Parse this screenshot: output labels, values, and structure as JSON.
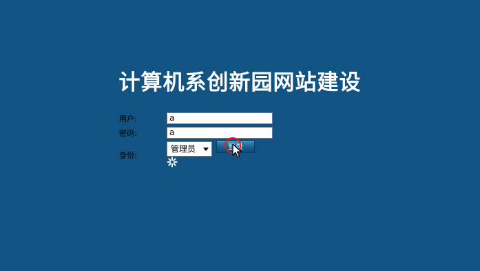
{
  "page": {
    "title": "计算机系创新园网站建设",
    "background_color": "#115383"
  },
  "login_form": {
    "user_label": "用户:",
    "user_value": "a",
    "password_label": "密码:",
    "password_value": "a",
    "role_label": "身份:",
    "role_selected": "管理员",
    "login_button_label": "登录"
  },
  "icons": {
    "loading": "loading-spinner-icon",
    "cursor": "mouse-pointer-icon",
    "click_indicator": "click-ring-icon"
  }
}
